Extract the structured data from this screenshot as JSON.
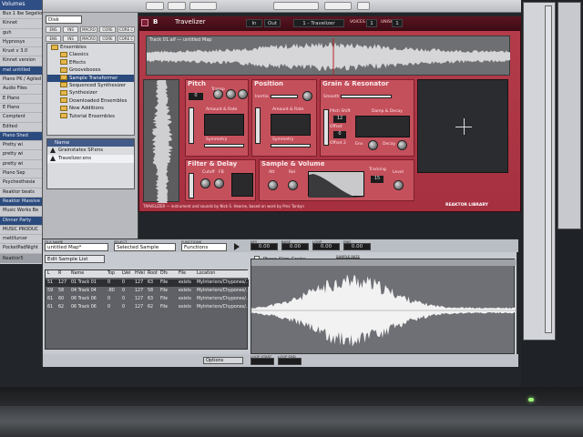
{
  "sidebar": {
    "title": "Volumes",
    "items": [
      "Bus 1 lbe Segelio",
      "Kinnet",
      "guh",
      "Hypnosys",
      "Krust v 3.0",
      "Kinnet version",
      "mel untitled",
      "Piano PK / Agiled",
      "Audio Files",
      "E Piano",
      "E Piano",
      "Comptent",
      "Edited",
      "Piano Shed",
      "Pretty wi",
      "pretty wi",
      "pretty wi",
      "Piano Sep",
      "Psychesthesia",
      "Reaktor beats",
      "Reaktor Massive",
      "Music Works Be",
      "Dinner Party",
      "MUSIC PRODUC",
      "metillurcer",
      "PocketPadNight"
    ],
    "bottom_label": "Reaktor5"
  },
  "browser": {
    "dropdown_value": "Disk",
    "toolbar_row1": [
      "ENS",
      "INS",
      "MACRO",
      "CORE",
      "CORE C"
    ],
    "toolbar_row2": [
      "ENS",
      "INS",
      "MACRO",
      "CORE",
      "CORE C"
    ],
    "tree": [
      {
        "label": "Ensembles",
        "selected": false
      },
      {
        "label": "Classics",
        "selected": false
      },
      {
        "label": "Effects",
        "selected": false
      },
      {
        "label": "Grooveboxes",
        "selected": false
      },
      {
        "label": "Sample Transformer",
        "selected": true
      },
      {
        "label": "Sequenced Synthesizer",
        "selected": false
      },
      {
        "label": "Synthesizer",
        "selected": false
      },
      {
        "label": "Downloaded Ensembles",
        "selected": false
      },
      {
        "label": "New Additions",
        "selected": false
      },
      {
        "label": "Tutorial Ensembles",
        "selected": false
      }
    ],
    "files_header": "Name",
    "files": [
      "Grainstates SP.ens",
      "Travelizer.ens"
    ]
  },
  "instrument": {
    "title": "Travelizer",
    "menu_value": "1 - Travelizer",
    "voices_label": "VOICES",
    "voices_value": "1",
    "unison_label": "UNISON",
    "unison_value": "1",
    "sample_caption": "Track 01.aif — untitled Map",
    "sections": {
      "pitch": "Pitch",
      "position": "Position",
      "grain": "Grain & Resonator",
      "filter": "Filter & Delay",
      "sample": "Sample & Volume"
    },
    "labels": {
      "transp": "Transp",
      "inertia": "Inertia",
      "amount_rate_1": "Amount & Rate",
      "amount_rate_2": "Amount & Rate",
      "symmetry_1": "Symmetry",
      "symmetry_2": "Symmetry",
      "smooth": "Smooth",
      "pitch_shift": "Pitch Shift",
      "offset": "Offset",
      "offset_2": "Offset 2",
      "env": "Env",
      "decay": "Decay",
      "damp_decay": "Damp & Decay",
      "cutoff": "Cutoff",
      "fb": "FB",
      "att": "Att",
      "rel": "Rel",
      "level": "Level",
      "tracking": "Tracking"
    },
    "values": {
      "pitch_shift": "12",
      "offset": "0",
      "tracking": "15"
    },
    "footer_credit": "TRAVELIZER — instrument and sounds by Nick S. Hearne, based on work by Prec Tonkyn",
    "brand": "REAKTOR LIBRARY"
  },
  "sample_map": {
    "file_name_label": "FILE NAME",
    "file_name": "untitled Map*",
    "select_label": "SELECT",
    "select_value": "Selected Sample",
    "functions_label": "FUNCTIONS",
    "functions_value": "Functions",
    "readouts": [
      {
        "label": "KEY",
        "value": "0.00"
      },
      {
        "label": "BASE",
        "value": "0.00"
      },
      {
        "label": "LOOP",
        "value": "0.00"
      },
      {
        "label": "END",
        "value": "0.00"
      }
    ],
    "list_mode": "Edit Sample List",
    "phase_align": "Phase Align Grains",
    "columns": [
      "L",
      "R",
      "Name",
      "Top",
      "LVel",
      "HVel",
      "Root",
      "Dfs",
      "File",
      "Location"
    ],
    "rows": [
      [
        "51",
        "127",
        "01 Track 01",
        "0",
        "0",
        "127",
        "63",
        "File",
        "exists",
        "MyInteriors/Chypones/..."
      ],
      [
        "59",
        "58",
        "04 Track 04",
        "-80",
        "0",
        "127",
        "58",
        "File",
        "exists",
        "MyInteriors/Chypones/..."
      ],
      [
        "61",
        "60",
        "06 Track 06",
        "0",
        "0",
        "127",
        "63",
        "File",
        "exists",
        "MyInteriors/Chypones/..."
      ],
      [
        "61",
        "62",
        "06 Track 06",
        "0",
        "0",
        "127",
        "62",
        "File",
        "exists",
        "MyInteriors/Chypones/..."
      ]
    ],
    "options_label": "Options",
    "loop_start_label": "LOOP START",
    "loop_end_label": "LOOP END",
    "sample_rate_label": "SAMPLE RATE",
    "sample_rate_value": "44100"
  },
  "colors": {
    "instrument_red": "#b43c4a",
    "selection_blue": "#2b4a7d",
    "waveform_white": "#f2f2f2"
  }
}
